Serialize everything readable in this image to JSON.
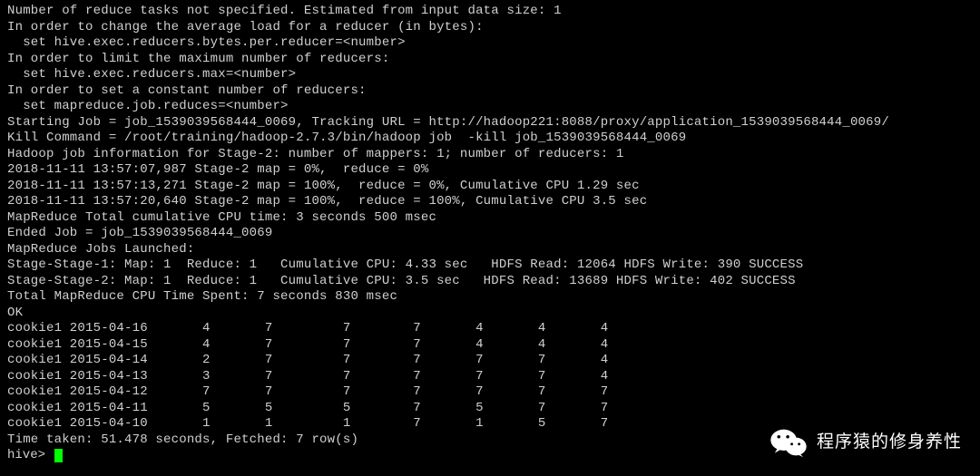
{
  "lines": [
    "Number of reduce tasks not specified. Estimated from input data size: 1",
    "In order to change the average load for a reducer (in bytes):",
    "  set hive.exec.reducers.bytes.per.reducer=<number>",
    "In order to limit the maximum number of reducers:",
    "  set hive.exec.reducers.max=<number>",
    "In order to set a constant number of reducers:",
    "  set mapreduce.job.reduces=<number>",
    "Starting Job = job_1539039568444_0069, Tracking URL = http://hadoop221:8088/proxy/application_1539039568444_0069/",
    "Kill Command = /root/training/hadoop-2.7.3/bin/hadoop job  -kill job_1539039568444_0069",
    "Hadoop job information for Stage-2: number of mappers: 1; number of reducers: 1",
    "2018-11-11 13:57:07,987 Stage-2 map = 0%,  reduce = 0%",
    "2018-11-11 13:57:13,271 Stage-2 map = 100%,  reduce = 0%, Cumulative CPU 1.29 sec",
    "2018-11-11 13:57:20,640 Stage-2 map = 100%,  reduce = 100%, Cumulative CPU 3.5 sec",
    "MapReduce Total cumulative CPU time: 3 seconds 500 msec",
    "Ended Job = job_1539039568444_0069",
    "MapReduce Jobs Launched:",
    "Stage-Stage-1: Map: 1  Reduce: 1   Cumulative CPU: 4.33 sec   HDFS Read: 12064 HDFS Write: 390 SUCCESS",
    "Stage-Stage-2: Map: 1  Reduce: 1   Cumulative CPU: 3.5 sec   HDFS Read: 13689 HDFS Write: 402 SUCCESS",
    "Total MapReduce CPU Time Spent: 7 seconds 830 msec",
    "OK"
  ],
  "table": {
    "rows": [
      {
        "id": "cookie1",
        "date": "2015-04-16",
        "v1": 4,
        "v2": 7,
        "v3": 7,
        "v4": 7,
        "v5": 4,
        "v6": 4,
        "v7": 4
      },
      {
        "id": "cookie1",
        "date": "2015-04-15",
        "v1": 4,
        "v2": 7,
        "v3": 7,
        "v4": 7,
        "v5": 4,
        "v6": 4,
        "v7": 4
      },
      {
        "id": "cookie1",
        "date": "2015-04-14",
        "v1": 2,
        "v2": 7,
        "v3": 7,
        "v4": 7,
        "v5": 7,
        "v6": 7,
        "v7": 4
      },
      {
        "id": "cookie1",
        "date": "2015-04-13",
        "v1": 3,
        "v2": 7,
        "v3": 7,
        "v4": 7,
        "v5": 7,
        "v6": 7,
        "v7": 4
      },
      {
        "id": "cookie1",
        "date": "2015-04-12",
        "v1": 7,
        "v2": 7,
        "v3": 7,
        "v4": 7,
        "v5": 7,
        "v6": 7,
        "v7": 7
      },
      {
        "id": "cookie1",
        "date": "2015-04-11",
        "v1": 5,
        "v2": 5,
        "v3": 5,
        "v4": 7,
        "v5": 5,
        "v6": 7,
        "v7": 7
      },
      {
        "id": "cookie1",
        "date": "2015-04-10",
        "v1": 1,
        "v2": 1,
        "v3": 1,
        "v4": 7,
        "v5": 1,
        "v6": 5,
        "v7": 7
      }
    ]
  },
  "time_taken": "Time taken: 51.478 seconds, Fetched: 7 row(s)",
  "prompt": "hive> ",
  "watermark": "程序猿的修身养性"
}
